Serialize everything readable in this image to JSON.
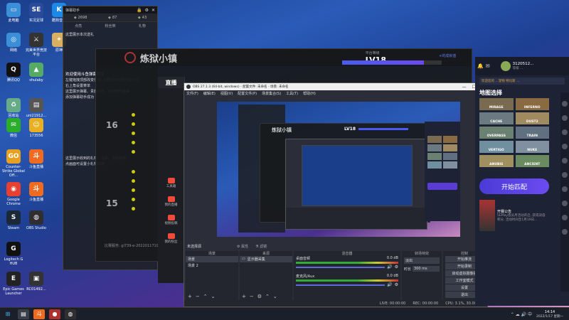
{
  "desktop_icons": [
    {
      "label": "此电脑",
      "color": "#3a8fd8",
      "glyph": "▭"
    },
    {
      "label": "实况足球",
      "color": "#2a4a9a",
      "glyph": "SE"
    },
    {
      "label": "酷狗音乐",
      "color": "#1e88e5",
      "glyph": "K"
    },
    {
      "label": "网络",
      "color": "#3a8fd8",
      "glyph": "◎"
    },
    {
      "label": "完美世界竞技平台",
      "color": "#333",
      "glyph": "⚔"
    },
    {
      "label": "原神",
      "color": "#d8b060",
      "glyph": "✦"
    },
    {
      "label": "腾讯QQ",
      "color": "#111",
      "glyph": "Q"
    },
    {
      "label": "shulaby",
      "color": "#5a6",
      "glyph": "▲"
    },
    {
      "label": "回收站",
      "color": "#6a8",
      "glyph": "♻"
    },
    {
      "label": "uni21912...",
      "color": "#555",
      "glyph": "▤"
    },
    {
      "label": "微信",
      "color": "#2aae2a",
      "glyph": "✉"
    },
    {
      "label": "173556",
      "color": "#e8b020",
      "glyph": "☺"
    },
    {
      "label": "Counter-Strike Global Off...",
      "color": "#e8a020",
      "glyph": "GO"
    },
    {
      "label": "斗鱼直播",
      "color": "#f06a20",
      "glyph": "斗"
    },
    {
      "label": "Google Chrome",
      "color": "#e84030",
      "glyph": "◉"
    },
    {
      "label": "斗鱼直播",
      "color": "#f06a20",
      "glyph": "斗"
    },
    {
      "label": "Steam",
      "color": "#1b2838",
      "glyph": "S"
    },
    {
      "label": "OBS Studio",
      "color": "#302e31",
      "glyph": "◍"
    },
    {
      "label": "Logitech G HUB",
      "color": "#111",
      "glyph": "G"
    },
    {
      "label": "Epic Games Launcher",
      "color": "#222",
      "glyph": "E"
    },
    {
      "label": "RC01492...",
      "color": "#333",
      "glyph": "▣"
    }
  ],
  "danmu": {
    "title": "弹幕助手",
    "tabs": [
      {
        "icon": "◆",
        "value": "2698"
      },
      {
        "icon": "◆",
        "value": "87"
      },
      {
        "icon": "◆",
        "value": "43"
      }
    ],
    "sub_tabs": [
      "点亮",
      "粉丝牌",
      "礼物"
    ],
    "line1": "这里展示本次送礼",
    "line_welcome": "欢迎使用斗鱼弹幕助手",
    "tips": [
      "左键拖拽顶部改变位置, 左键拉伸四周改变大小",
      "右上角设置菜单",
      "这里展示弹幕、贵族信息、粉丝牌升级等",
      "添加弹幕助手成功"
    ],
    "gift_tips": [
      "这里展示收到的礼物、道具、贵族开通",
      "点画面可设置小礼物屏蔽"
    ]
  },
  "game_window": {
    "title": "炼狱小镇",
    "level_label": "平台等级",
    "level": "LV18",
    "exp_label": "+的成就值",
    "level_progress": 0.82,
    "footer": "比赛服务: gl739-e-2022011719",
    "stat_numbers": [
      "16",
      "15"
    ]
  },
  "obs_window": {
    "title": "OBS 27.1.3 (64-bit, windows) - 配置文件: 未命名 - 场景: 未命名",
    "menu": [
      "文件(F)",
      "编辑(E)",
      "视图(V)",
      "配置文件(P)",
      "场景集合(S)",
      "工具(T)",
      "帮助(H)"
    ],
    "minimize": "—",
    "maximize": "☐",
    "close": "✕",
    "scene_bar": {
      "label": "未选择源",
      "props": "⚙ 属性",
      "filter": "⚗ 滤镜"
    },
    "docks": {
      "scenes": {
        "title": "场景",
        "items": [
          "场景",
          "场景 2"
        ]
      },
      "sources": {
        "title": "来源",
        "items": [
          "显示器采集"
        ]
      },
      "mixer": {
        "title": "混音器",
        "tracks": [
          {
            "name": "桌面音频",
            "level": "0.0 dB"
          },
          {
            "name": "麦克风/Aux",
            "level": "0.0 dB"
          }
        ]
      },
      "transitions": {
        "title": "转场特效",
        "type": "淡出",
        "duration_label": "时长",
        "duration": "300 ms"
      },
      "controls": {
        "title": "控制",
        "buttons": [
          "开始推流",
          "开始录制",
          "启动虚拟摄像机",
          "工作室模式",
          "设置",
          "退出"
        ]
      }
    },
    "status": {
      "live": "LIVE: 00:00:00",
      "rec": "REC: 00:00:00",
      "cpu": "CPU: 3.1%, 30.00 fps"
    }
  },
  "douyu_side": {
    "logo": "直播",
    "items": [
      "工具箱",
      "我的直播",
      "视频投稿",
      "我的粉丝"
    ],
    "badges": [
      "",
      "",
      "",
      ""
    ]
  },
  "csgo_panel": {
    "user": "3120512...",
    "user_sub": "等级 ...",
    "notice": "欢迎您的 ...宠物 特比斯 ...",
    "section_title": "地图选择",
    "maps": [
      {
        "name": "MIRAGE",
        "color": "#7a6a50"
      },
      {
        "name": "INFERNO",
        "color": "#8a6a40"
      },
      {
        "name": "CACHE",
        "color": "#6a7a80"
      },
      {
        "name": "DUST2",
        "color": "#a08a60"
      },
      {
        "name": "OVERPASS",
        "color": "#6a8070"
      },
      {
        "name": "TRAIN",
        "color": "#607080"
      },
      {
        "name": "VERTIGO",
        "color": "#7090a0"
      },
      {
        "name": "NUKE",
        "color": "#8090a0"
      },
      {
        "name": "ANUBIS",
        "color": "#a09060"
      },
      {
        "name": "ANCIENT",
        "color": "#6a8a60"
      }
    ],
    "start_button": "开始匹配",
    "news_title": "开赛公告",
    "news_text": "5EPlay会员月活动开启, 获得双倍积分, 活动时间至1月19日...",
    "avatar_labels": [
      "朋",
      "友",
      "列",
      "表"
    ]
  },
  "tray": {
    "time": "14:14",
    "date": "2022/1/17 星期一"
  },
  "colors": {
    "accent": "#5b3bd6",
    "obs_bg": "#2b2e38",
    "csgo_bg": "#1d2235",
    "danmu_bg": "#1e2128"
  }
}
